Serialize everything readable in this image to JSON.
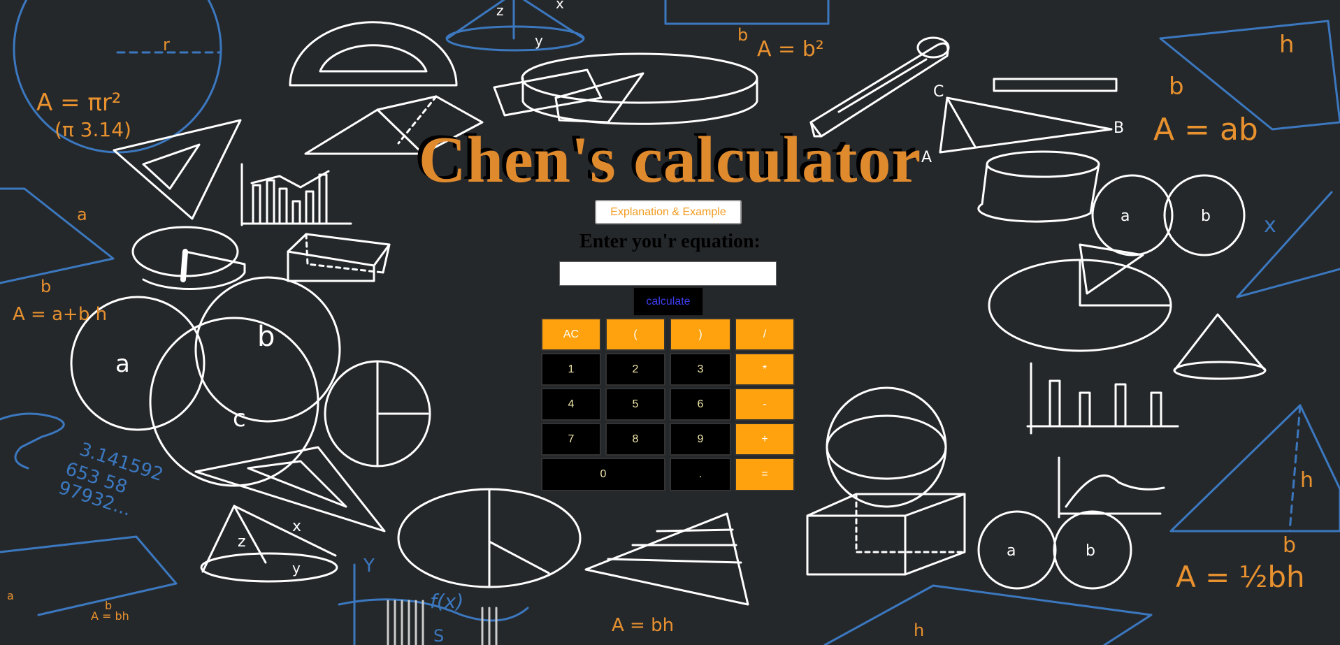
{
  "header": {
    "title": "Chen's calculator"
  },
  "explain_button": {
    "label": "Explanation & Example"
  },
  "prompt": {
    "text": "Enter you'r equation:"
  },
  "equation_input": {
    "value": "",
    "placeholder": ""
  },
  "calculate_button": {
    "label": "calculate"
  },
  "keypad": {
    "ac": "AC",
    "lparen": "(",
    "rparen": ")",
    "divide": "/",
    "one": "1",
    "two": "2",
    "three": "3",
    "multiply": "*",
    "four": "4",
    "five": "5",
    "six": "6",
    "minus": "-",
    "seven": "7",
    "eight": "8",
    "nine": "9",
    "plus": "+",
    "zero": "0",
    "dot": ".",
    "equals": "="
  },
  "colors": {
    "accent": "#ffa20d",
    "title": "#e08a2e",
    "background": "#25282b",
    "chalk_blue": "#3b78bf",
    "chalk_orange": "#e8912f"
  },
  "background_art": {
    "f1": "A = πr²",
    "f2": "(π 3.14)",
    "f3": "r",
    "f4": "A = b²",
    "f5": "b",
    "f6": "A = ab",
    "f7": "h",
    "f8": "b",
    "f9": "a",
    "f10": "b",
    "f11": "A = a+b h",
    "f12": "a",
    "f13": "b",
    "f14": "c",
    "f15": "3.141592",
    "f16": "653 58",
    "f17": "97932...",
    "f18": "a",
    "f19": "b",
    "f20": "A = bh",
    "f21": "f(x)",
    "f22": "S",
    "f23": "Y",
    "f24": "A = bh",
    "f25": "C",
    "f26": "B",
    "f27": "A",
    "f28": "a",
    "f29": "b",
    "f30": "x",
    "f31": "h",
    "f32": "b",
    "f33": "A = ½bh",
    "f34": "a",
    "f35": "b",
    "f36": "h",
    "f37": "z",
    "f38": "x",
    "f39": "y",
    "f40": "z",
    "f41": "y",
    "f42": "x"
  }
}
